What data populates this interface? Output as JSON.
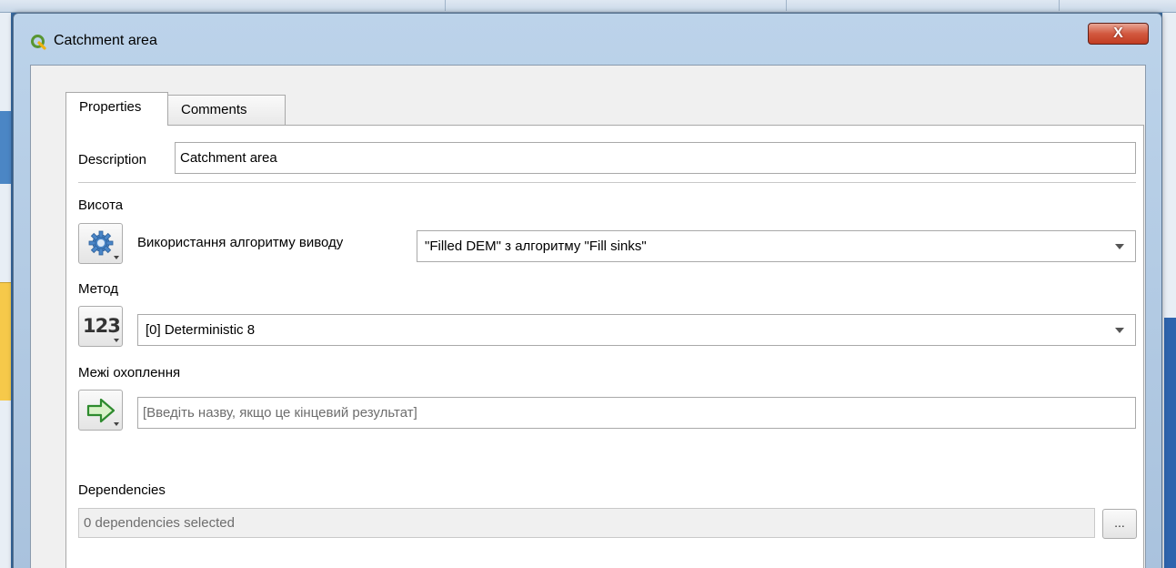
{
  "window": {
    "title": "Catchment area",
    "close_label": "X"
  },
  "tabs": [
    {
      "label": "Properties",
      "active": true
    },
    {
      "label": "Comments",
      "active": false
    }
  ],
  "form": {
    "description": {
      "label": "Description",
      "value": "Catchment area"
    },
    "height": {
      "section_label": "Висота",
      "source_label": "Використання алгоритму виводу",
      "selected": "\"Filled DEM\" з алгоритму \"Fill sinks\""
    },
    "method": {
      "section_label": "Метод",
      "selected": "[0] Deterministic 8"
    },
    "catchment_bounds": {
      "section_label": "Межі охоплення",
      "placeholder": "[Введіть назву, якщо це кінцевий результат]"
    },
    "dependencies": {
      "section_label": "Dependencies",
      "value": "0 dependencies selected",
      "browse_label": "..."
    }
  },
  "icons": {
    "app": "qgis-logo-icon",
    "algorithm": "gear-icon",
    "number": "number-123-icon",
    "output": "green-arrow-icon"
  },
  "colors": {
    "title_bar": "#bcd3ea",
    "close_button": "#c23d22",
    "gear": "#4a86c8",
    "arrow_green": "#2e8b2e"
  }
}
